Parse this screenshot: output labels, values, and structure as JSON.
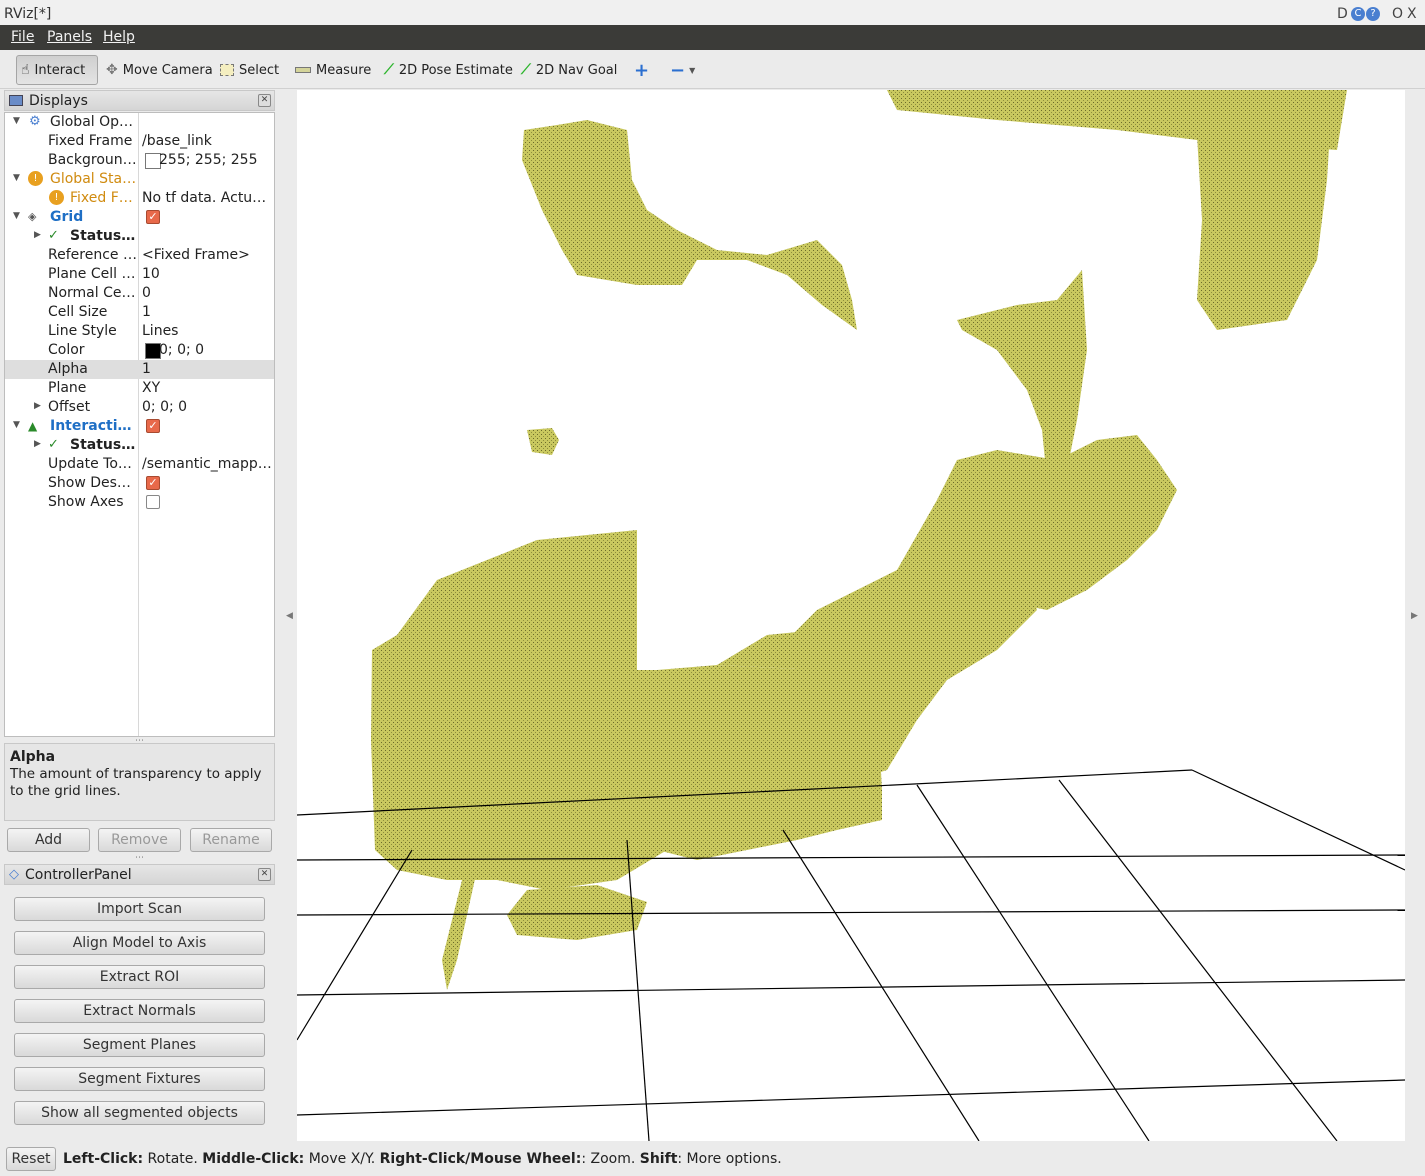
{
  "window": {
    "title": "RViz[*]",
    "controls": [
      "D",
      "C",
      "?",
      "O",
      "X"
    ]
  },
  "menu": [
    "File",
    "Panels",
    "Help"
  ],
  "toolbar": [
    {
      "label": "Interact",
      "icon": "hand-pointer-icon",
      "active": true
    },
    {
      "label": "Move Camera",
      "icon": "move-camera-icon",
      "active": false
    },
    {
      "label": "Select",
      "icon": "select-rect-icon",
      "active": false
    },
    {
      "label": "Measure",
      "icon": "ruler-icon",
      "active": false
    },
    {
      "label": "2D Pose Estimate",
      "icon": "green-arrow-icon",
      "active": false
    },
    {
      "label": "2D Nav Goal",
      "icon": "green-arrow-icon",
      "active": false
    }
  ],
  "displays": {
    "title": "Displays",
    "rows": [
      {
        "name": "Global Op…",
        "value": ""
      },
      {
        "name": "Fixed Frame",
        "value": "/base_link"
      },
      {
        "name": "Backgroun…",
        "value": "255; 255; 255"
      },
      {
        "name": "Global Sta…",
        "value": ""
      },
      {
        "name": "Fixed F…",
        "value": "No tf data.  Actu…"
      },
      {
        "name": "Grid",
        "value": ""
      },
      {
        "name": "Status: …",
        "value": ""
      },
      {
        "name": "Reference …",
        "value": "<Fixed Frame>"
      },
      {
        "name": "Plane Cell …",
        "value": "10"
      },
      {
        "name": "Normal Ce…",
        "value": "0"
      },
      {
        "name": "Cell Size",
        "value": "1"
      },
      {
        "name": "Line Style",
        "value": "Lines"
      },
      {
        "name": "Color",
        "value": "0; 0; 0"
      },
      {
        "name": "Alpha",
        "value": "1"
      },
      {
        "name": "Plane",
        "value": "XY"
      },
      {
        "name": "Offset",
        "value": "0; 0; 0"
      },
      {
        "name": "Interactiv…",
        "value": ""
      },
      {
        "name": "Status: …",
        "value": ""
      },
      {
        "name": "Update To…",
        "value": "/semantic_mapp…"
      },
      {
        "name": "Show Desc…",
        "value": ""
      },
      {
        "name": "Show Axes",
        "value": ""
      }
    ],
    "help_title": "Alpha",
    "help_text": "The amount of transparency to apply to the grid lines.",
    "buttons": {
      "add": "Add",
      "remove": "Remove",
      "rename": "Rename"
    }
  },
  "controller": {
    "title": "ControllerPanel",
    "buttons": [
      "Import Scan",
      "Align Model to Axis",
      "Extract ROI",
      "Extract Normals",
      "Segment Planes",
      "Segment Fixtures",
      "Show all segmented objects"
    ]
  },
  "statusbar": {
    "reset": "Reset",
    "parts": [
      {
        "b": "Left-Click:",
        "t": " Rotate. "
      },
      {
        "b": "Middle-Click:",
        "t": " Move X/Y. "
      },
      {
        "b": "Right-Click/Mouse Wheel:",
        "t": ": Zoom. "
      },
      {
        "b": "Shift",
        "t": ": More options."
      }
    ]
  },
  "colors": {
    "pointcloud": "#c9c85f",
    "pointcloud_dark": "#a8a84a",
    "grid": "#000000",
    "warning": "#e8a020",
    "link_blue": "#1f6fc5"
  }
}
